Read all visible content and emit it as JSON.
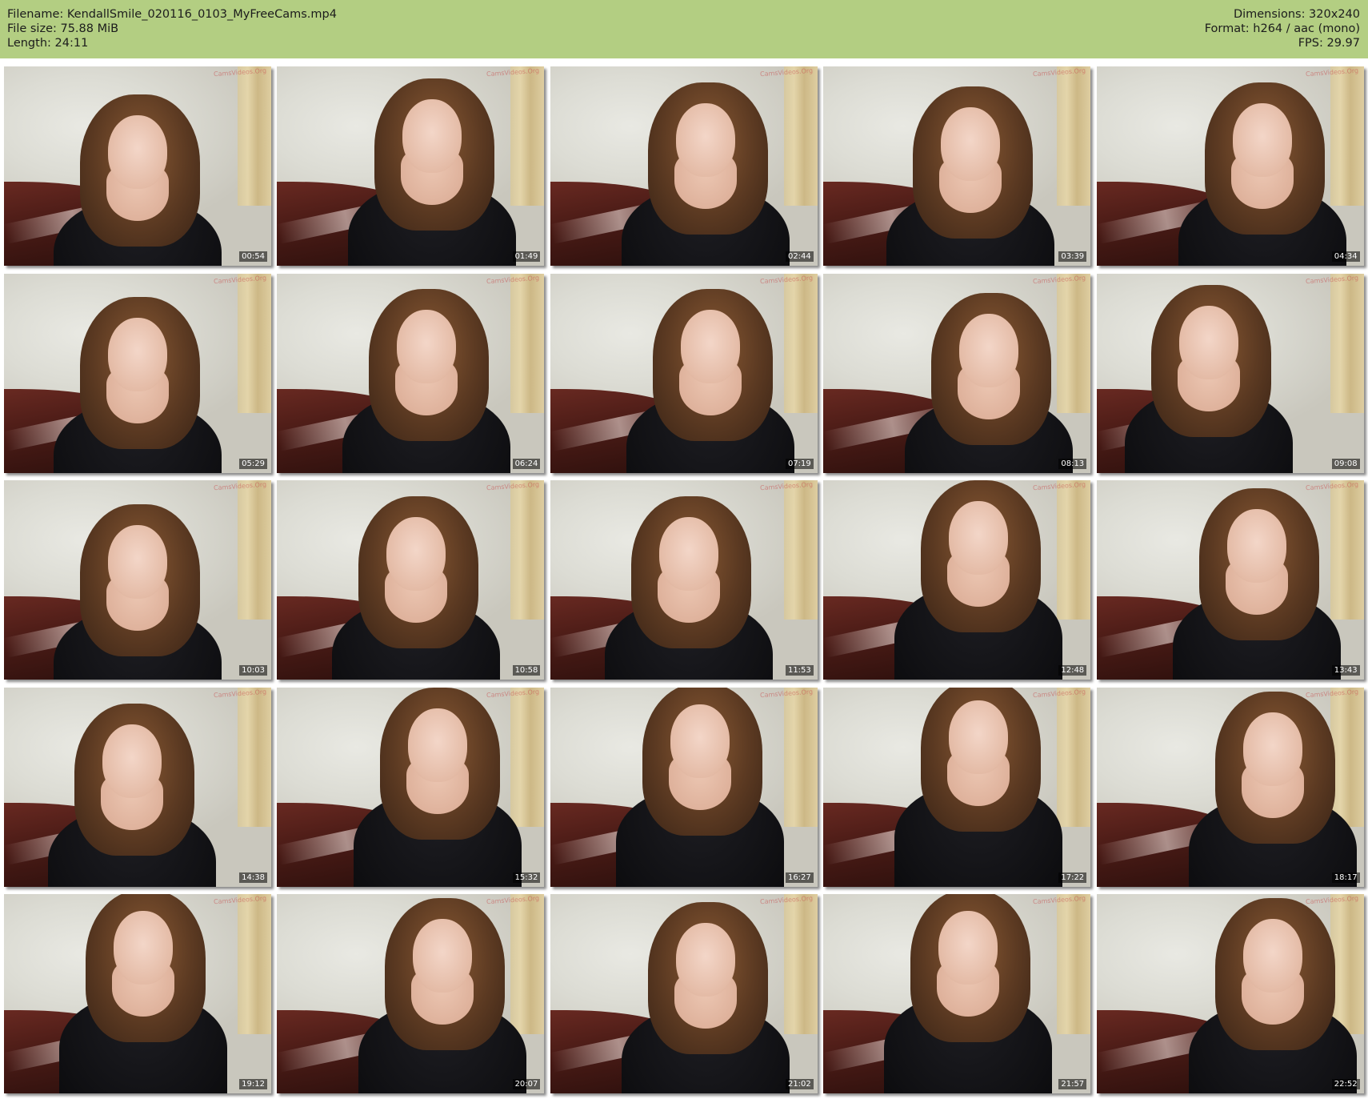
{
  "header": {
    "filename": "Filename: KendallSmile_020116_0103_MyFreeCams.mp4",
    "filesize": "File size: 75.88 MiB",
    "length": "Length: 24:11",
    "dimensions": "Dimensions: 320x240",
    "format": "Format: h264 / aac (mono)",
    "fps": "FPS: 29.97"
  },
  "thumbnails": [
    {
      "time": "00:54"
    },
    {
      "time": "01:49"
    },
    {
      "time": "02:44"
    },
    {
      "time": "03:39"
    },
    {
      "time": "04:34"
    },
    {
      "time": "05:29"
    },
    {
      "time": "06:24"
    },
    {
      "time": "07:19"
    },
    {
      "time": "08:13"
    },
    {
      "time": "09:08"
    },
    {
      "time": "10:03"
    },
    {
      "time": "10:58"
    },
    {
      "time": "11:53"
    },
    {
      "time": "12:48"
    },
    {
      "time": "13:43"
    },
    {
      "time": "14:38"
    },
    {
      "time": "15:32"
    },
    {
      "time": "16:27"
    },
    {
      "time": "17:22"
    },
    {
      "time": "18:17"
    },
    {
      "time": "19:12"
    },
    {
      "time": "20:07"
    },
    {
      "time": "21:02"
    },
    {
      "time": "21:57"
    },
    {
      "time": "22:52"
    }
  ],
  "watermark_text": "CamsVideos.Org"
}
